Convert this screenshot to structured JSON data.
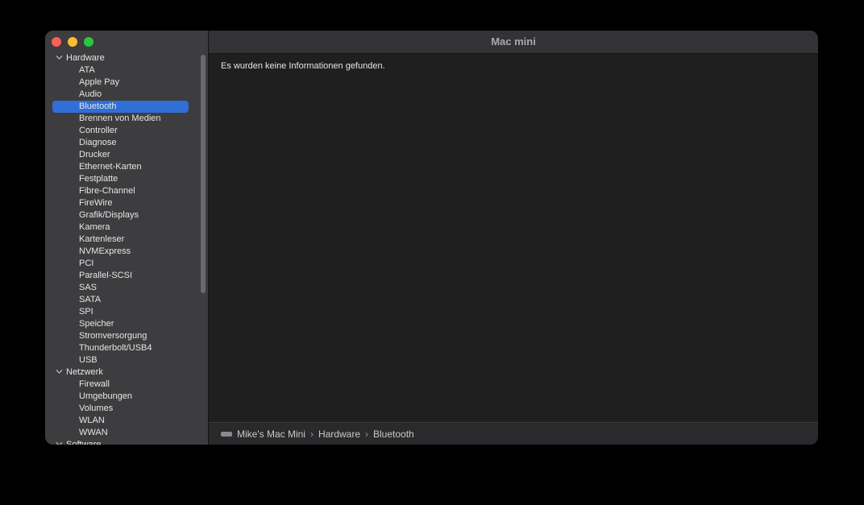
{
  "window": {
    "title": "Mac mini"
  },
  "sidebar": {
    "groups": [
      {
        "label": "Hardware",
        "items": [
          "ATA",
          "Apple Pay",
          "Audio",
          "Bluetooth",
          "Brennen von Medien",
          "Controller",
          "Diagnose",
          "Drucker",
          "Ethernet-Karten",
          "Festplatte",
          "Fibre-Channel",
          "FireWire",
          "Grafik/Displays",
          "Kamera",
          "Kartenleser",
          "NVMExpress",
          "PCI",
          "Parallel-SCSI",
          "SAS",
          "SATA",
          "SPI",
          "Speicher",
          "Stromversorgung",
          "Thunderbolt/USB4",
          "USB"
        ]
      },
      {
        "label": "Netzwerk",
        "items": [
          "Firewall",
          "Umgebungen",
          "Volumes",
          "WLAN",
          "WWAN"
        ]
      },
      {
        "label": "Software",
        "items": []
      }
    ],
    "selected": "Bluetooth"
  },
  "main": {
    "message": "Es wurden keine Informationen gefunden."
  },
  "pathbar": {
    "computer_icon": "mac-mini-icon",
    "crumbs": [
      "Mike's Mac Mini",
      "Hardware",
      "Bluetooth"
    ],
    "separator": "›"
  },
  "colors": {
    "selection": "#2f6fd6",
    "sidebar_bg": "#3d3c3e",
    "content_bg": "#1f1f1f"
  }
}
